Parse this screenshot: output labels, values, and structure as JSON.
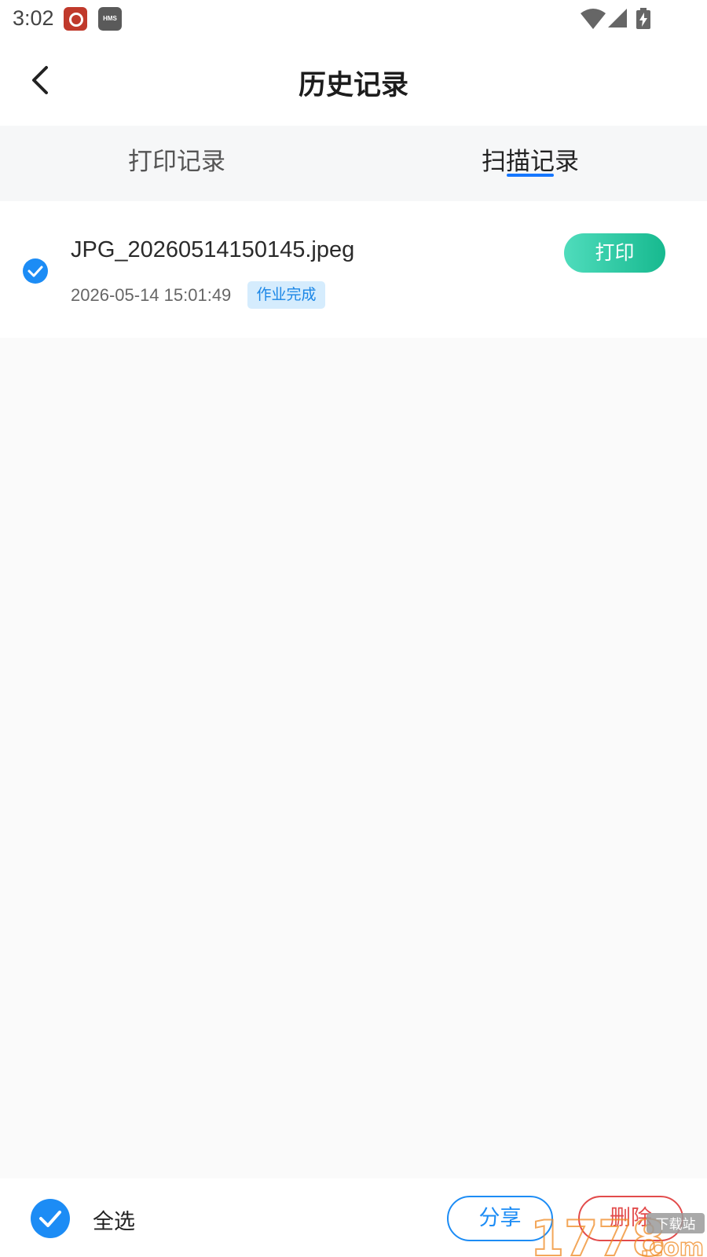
{
  "status_bar": {
    "time": "3:02",
    "notifications": [
      "weibo-icon",
      "hms-icon"
    ],
    "hms_text": "HMS",
    "system_icons": [
      "wifi-icon",
      "signal-icon",
      "battery-charging-icon"
    ]
  },
  "header": {
    "title": "历史记录",
    "back_icon": "chevron-left-icon"
  },
  "tabs": [
    {
      "label": "打印记录",
      "active": false
    },
    {
      "label": "扫描记录",
      "active": true
    }
  ],
  "records": [
    {
      "filename": "JPG_20260514150145.jpeg",
      "timestamp": "2026-05-14 15:01:49",
      "status": "作业完成",
      "checked": true,
      "action_label": "打印"
    }
  ],
  "bottom_bar": {
    "select_all_label": "全选",
    "select_all_checked": true,
    "share_label": "分享",
    "delete_label": "删除"
  },
  "watermark": {
    "text": "1778",
    "suffix": ".com",
    "site_label": "下载站"
  },
  "colors": {
    "accent": "#1c8cf5",
    "print_button": "#2cc9a0",
    "delete": "#e24b4b",
    "badge_bg": "#d5ecfd"
  }
}
